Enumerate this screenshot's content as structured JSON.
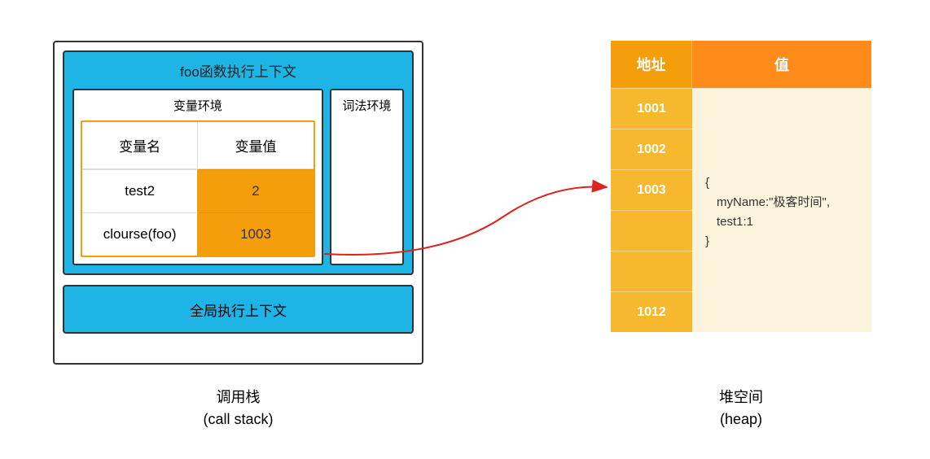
{
  "callstack": {
    "foo_context_title": "foo函数执行上下文",
    "var_env_title": "变量环境",
    "lex_env_title": "词法环境",
    "var_name_header": "变量名",
    "var_value_header": "变量值",
    "rows": [
      {
        "name": "test2",
        "value": "2"
      },
      {
        "name": "clourse(foo)",
        "value": "1003"
      }
    ],
    "global_context_title": "全局执行上下文",
    "label_cn": "调用栈",
    "label_en": "(call stack)"
  },
  "heap": {
    "addr_header": "地址",
    "val_header": "值",
    "addresses": [
      "1001",
      "1002",
      "1003",
      "",
      "",
      "1012"
    ],
    "object_lines": [
      "{",
      "myName:\"极客时间\",",
      "test1:1",
      "}"
    ],
    "label_cn": "堆空间",
    "label_en": "(heap)"
  }
}
